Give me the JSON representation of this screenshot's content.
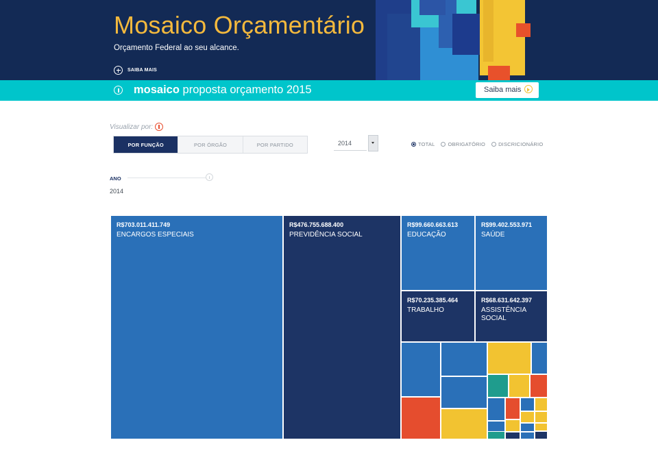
{
  "header": {
    "title": "Mosaico Orçamentário",
    "subtitle": "Orçamento Federal ao seu alcance.",
    "saiba_mais": "SAIBA MAIS"
  },
  "banner": {
    "brand": "mosaico",
    "text": "proposta orçamento 2015",
    "button": "Saiba mais"
  },
  "controls": {
    "visualizar_label": "Visualizar por:",
    "view_buttons": [
      "POR FUNÇÃO",
      "POR ÓRGÃO",
      "POR PARTIDO"
    ],
    "year": "2014",
    "radios": [
      "TOTAL",
      "OBRIGATÓRIO",
      "DISCRICIONÁRIO"
    ],
    "selected_radio": "TOTAL",
    "ano_label": "ANO",
    "ano_value": "2014"
  },
  "colors": {
    "navy": "#1b3163",
    "blue": "#2a70b8",
    "yellow": "#f2c331",
    "red": "#e54d2e",
    "teal": "#1f9c8d",
    "cyan": "#00c5cb",
    "gold": "#f4b93d"
  },
  "treemap": {
    "labeled": [
      {
        "amount": "R$703.011.411.749",
        "name": "ENCARGOS ESPECIAIS",
        "color": "#2a70b8"
      },
      {
        "amount": "R$476.755.688.400",
        "name": "PREVIDÊNCIA SOCIAL",
        "color": "#1d3465"
      },
      {
        "amount": "R$99.660.663.613",
        "name": "EDUCAÇÃO",
        "color": "#2a70b8"
      },
      {
        "amount": "R$99.402.553.971",
        "name": "SAÚDE",
        "color": "#2a70b8"
      },
      {
        "amount": "R$70.235.385.464",
        "name": "TRABALHO",
        "color": "#1d3465"
      },
      {
        "amount": "R$68.631.642.397",
        "name": "ASSISTÊNCIA SOCIAL",
        "color": "#1d3465"
      }
    ],
    "small_tile_colors": [
      "#2a70b8",
      "#e54d2e",
      "#2a70b8",
      "#2a70b8",
      "#f2c331",
      "#f2c331",
      "#2a70b8",
      "#1f9c8d",
      "#f2c331",
      "#e54d2e",
      "#2a70b8",
      "#e54d2e",
      "#2a70b8",
      "#f2c331",
      "#2a70b8",
      "#f2c331",
      "#f2c331",
      "#1d3465",
      "#2a70b8",
      "#f2c331",
      "#f2c331",
      "#2a70b8",
      "#1d3465",
      "#1f9c8d",
      "#e54d2e"
    ]
  }
}
